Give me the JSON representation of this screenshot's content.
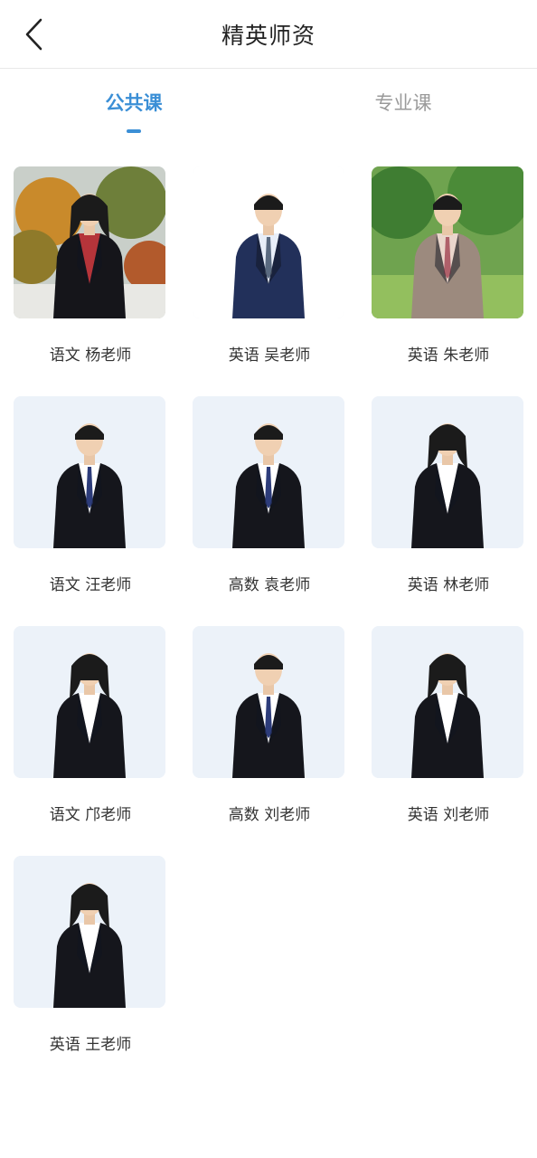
{
  "header": {
    "title": "精英师资",
    "back_icon": "chevron-left-icon"
  },
  "tabs": [
    {
      "label": "公共课",
      "active": true
    },
    {
      "label": "专业课",
      "active": false
    }
  ],
  "colors": {
    "accent": "#3b8fd6",
    "inactive": "#9a9a9a",
    "photo_bg": "#ecf2f9"
  },
  "teachers": [
    {
      "subject": "语文",
      "name": "杨老师",
      "label": "语文 杨老师",
      "photo": "outdoor-autumn"
    },
    {
      "subject": "英语",
      "name": "吴老师",
      "label": "英语 吴老师",
      "photo": "white-bg-male"
    },
    {
      "subject": "英语",
      "name": "朱老师",
      "label": "英语 朱老师",
      "photo": "outdoor-green"
    },
    {
      "subject": "语文",
      "name": "汪老师",
      "label": "语文 汪老师",
      "photo": "studio-male"
    },
    {
      "subject": "高数",
      "name": "袁老师",
      "label": "高数 袁老师",
      "photo": "studio-male"
    },
    {
      "subject": "英语",
      "name": "林老师",
      "label": "英语 林老师",
      "photo": "studio-female"
    },
    {
      "subject": "语文",
      "name": "邝老师",
      "label": "语文 邝老师",
      "photo": "studio-female"
    },
    {
      "subject": "高数",
      "name": "刘老师",
      "label": "高数 刘老师",
      "photo": "studio-male"
    },
    {
      "subject": "英语",
      "name": "刘老师",
      "label": "英语 刘老师",
      "photo": "studio-female"
    },
    {
      "subject": "英语",
      "name": "王老师",
      "label": "英语 王老师",
      "photo": "studio-female"
    }
  ]
}
